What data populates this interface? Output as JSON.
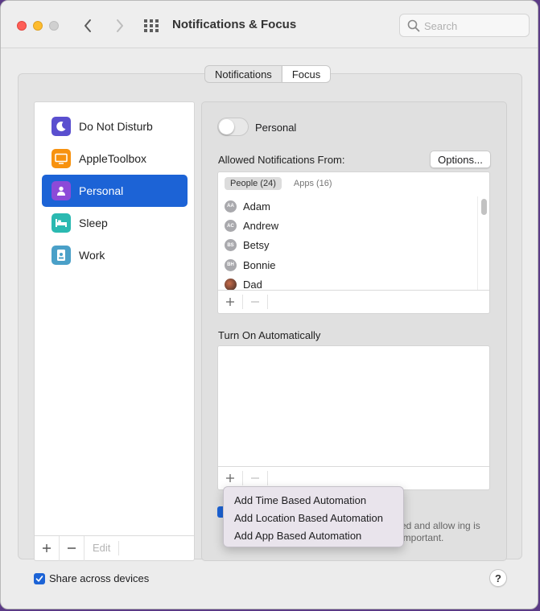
{
  "window": {
    "title": "Notifications & Focus",
    "search_placeholder": "Search"
  },
  "tabs": [
    {
      "label": "Notifications",
      "active": false
    },
    {
      "label": "Focus",
      "active": true
    }
  ],
  "sidebar": {
    "items": [
      {
        "label": "Do Not Disturb",
        "icon": "moon-icon",
        "color": "#5a4fcf"
      },
      {
        "label": "AppleToolbox",
        "icon": "monitor-icon",
        "color": "#f7920f"
      },
      {
        "label": "Personal",
        "icon": "person-icon",
        "color": "#8c4ad8",
        "selected": true
      },
      {
        "label": "Sleep",
        "icon": "bed-icon",
        "color": "#2bb9b1"
      },
      {
        "label": "Work",
        "icon": "badge-icon",
        "color": "#4aa0c8"
      }
    ],
    "edit_label": "Edit"
  },
  "detail": {
    "toggle_label": "Personal",
    "allowed_label": "Allowed Notifications From:",
    "options_label": "Options...",
    "list_tabs": [
      "People (24)",
      "Apps (16)"
    ],
    "people": [
      {
        "initials": "AA",
        "name": "Adam"
      },
      {
        "initials": "AC",
        "name": "Andrew"
      },
      {
        "initials": "BS",
        "name": "Betsy"
      },
      {
        "initials": "BH",
        "name": "Bonnie"
      },
      {
        "initials": "",
        "name": "Dad"
      }
    ],
    "turn_on_label": "Turn On Automatically",
    "description_fragment": "ed and allow ing is important."
  },
  "popup_menu": {
    "items": [
      "Add Time Based Automation",
      "Add Location Based Automation",
      "Add App Based Automation"
    ]
  },
  "footer": {
    "share_label": "Share across devices",
    "share_checked": true,
    "help_label": "?"
  },
  "colors": {
    "accent": "#1c63d6"
  }
}
